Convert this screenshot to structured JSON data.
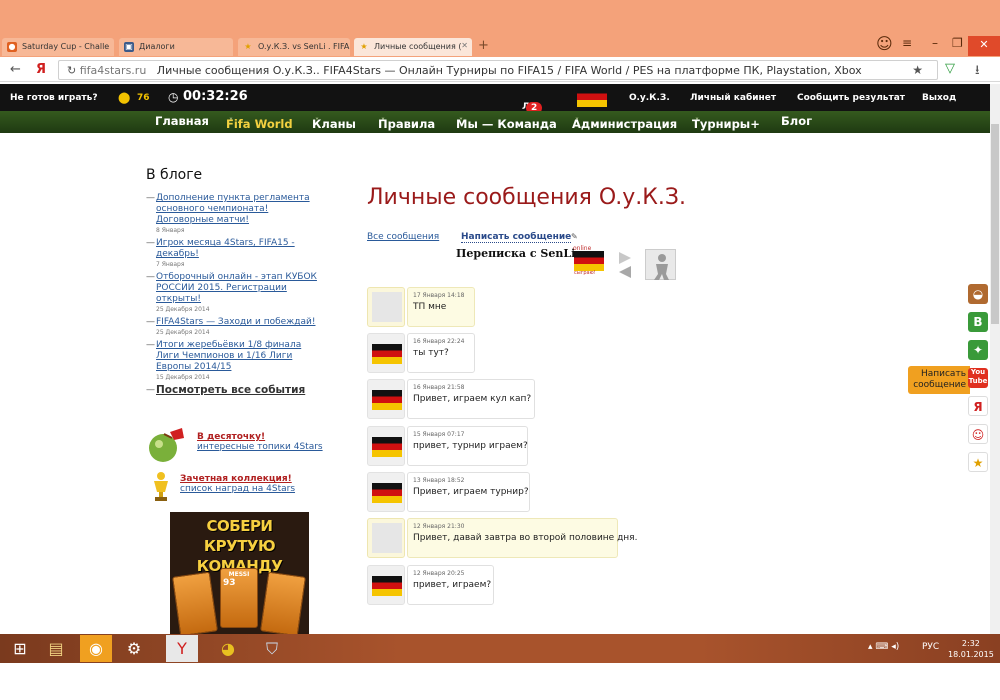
{
  "browser": {
    "tabs": [
      {
        "label": "Saturday Cup - Challe",
        "active": false
      },
      {
        "label": "Диалоги",
        "active": false
      },
      {
        "label": "O.у.К.З. vs SenLi . FIFA",
        "active": false
      },
      {
        "label": "Личные сообщения (",
        "active": true
      }
    ],
    "new_tab": "+",
    "back_icon": "back-arrow-icon",
    "ya_label": "Я",
    "reload_icon": "reload-icon",
    "url_host": "fifa4stars.ru",
    "url_title": "Личные сообщения O.у.К.З.. FIFA4Stars — Онлайн Турниры по FIFA15 / FIFA World / PES на платформе ПК, Playstation, Xbox"
  },
  "site": {
    "not_ready": "Не готов играть?",
    "coins": "76",
    "timer": "00:32:26",
    "ls_label": "ЛС",
    "ls_count": "2",
    "username": "O.у.К.З.",
    "cabinet": "Личный кабинет",
    "report": "Сообщить результат",
    "logout": "Выход",
    "nav": [
      "Главная",
      "Fifa World",
      "Кланы",
      "Правила",
      "Мы — Команда",
      "Администрация",
      "Турниры+",
      "Блог"
    ]
  },
  "sidebar": {
    "heading": "В блоге",
    "items": [
      {
        "title": "Дополнение пункта регламента основного чемпионата! Договорные матчи!",
        "date": "8 Января"
      },
      {
        "title": "Игрок месяца 4Stars, FIFA15 - декабрь!",
        "date": "7 Января"
      },
      {
        "title": "Отборочный онлайн - этап КУБОК РОССИИ 2015. Регистрации открыты!",
        "date": "25 Декабря 2014"
      },
      {
        "title": "FIFA4Stars — Заходи и побеждай!",
        "date": "25 Декабря 2014"
      },
      {
        "title": "Итоги жеребьёвки 1/8 финала Лиги Чемпионов и 1/16 Лиги Европы 2014/15",
        "date": "15 Декабря 2014"
      }
    ],
    "all_events": "Посмотреть все события",
    "promo1_title": "В десяточку!",
    "promo1_sub": "интересные топики 4Stars",
    "promo2_title": "Зачетная коллекция!",
    "promo2_sub": "список наград на 4Stars",
    "banner_text": "СОБЕРИ КРУТУЮ КОМАНДУ",
    "banner_card_label": "MESSI",
    "banner_card_rating": "93"
  },
  "main": {
    "title": "Личные сообщения O.у.К.З.",
    "all_messages": "Все сообщения",
    "write_message": "Написать сообщение",
    "conversation": "Переписка с SenLi",
    "online": "online",
    "sygrayu": "сыграю!",
    "messages": [
      {
        "date": "17 Января 14:18",
        "text": "ТП мне",
        "mine": true
      },
      {
        "date": "16 Января 22:24",
        "text": "ты тут?",
        "mine": false
      },
      {
        "date": "16 Января 21:58",
        "text": "Привет, играем кул кап?",
        "mine": false
      },
      {
        "date": "15 Января 07:17",
        "text": "привет, турнир играем?",
        "mine": false
      },
      {
        "date": "13 Января 18:52",
        "text": "Привет, играем турнир?",
        "mine": false
      },
      {
        "date": "12 Января 21:30",
        "text": "Привет, давай завтра во второй половине дня.",
        "mine": true
      },
      {
        "date": "12 Января 20:25",
        "text": "привет, играем?",
        "mine": false
      }
    ]
  },
  "floating": {
    "write_btn": "Написать сообщение",
    "vk": "B",
    "ya": "Я",
    "yt": "You Tube"
  },
  "taskbar": {
    "lang": "РУС",
    "time": "2:32",
    "date": "18.01.2015"
  }
}
